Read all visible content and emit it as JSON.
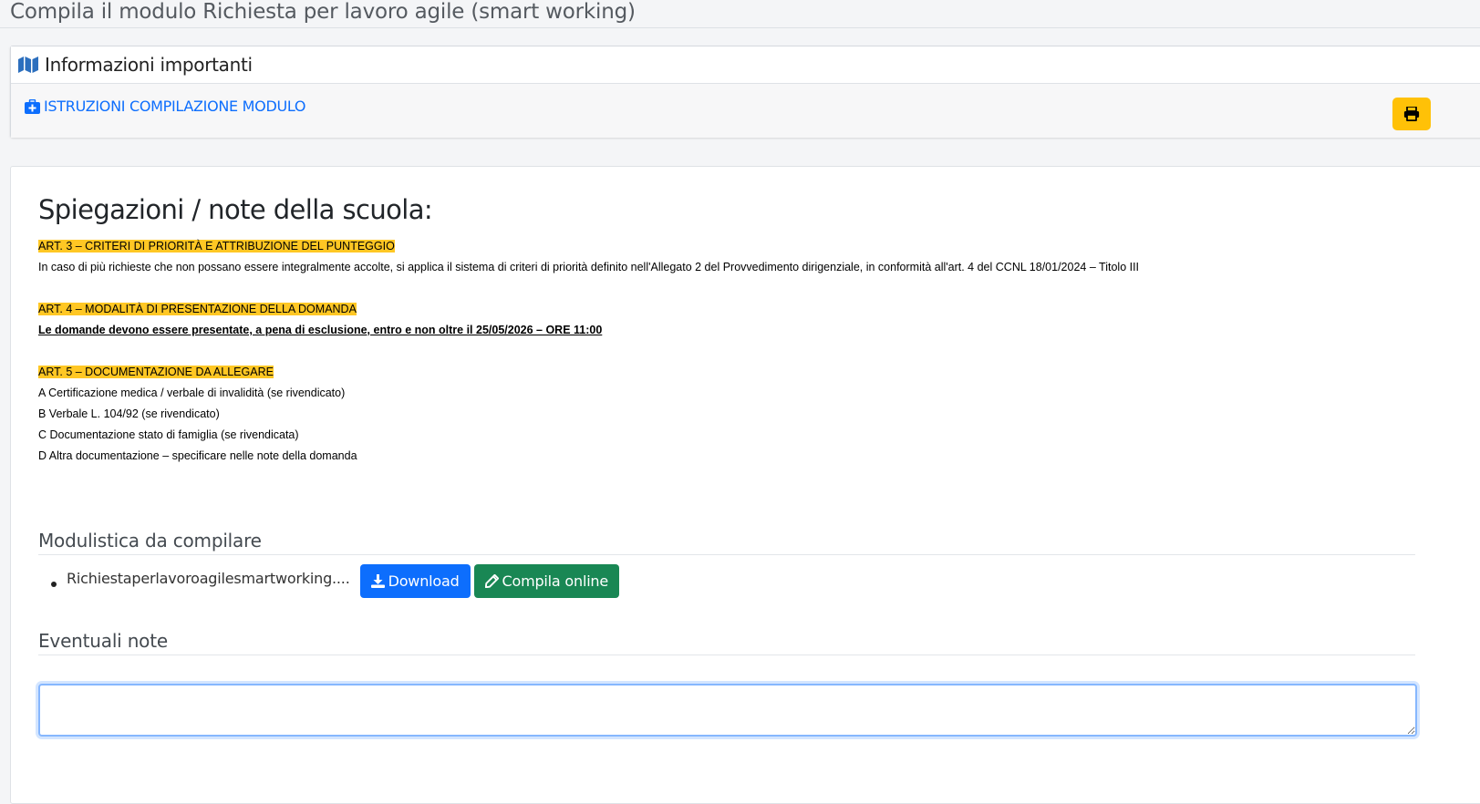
{
  "page": {
    "title": "Compila il modulo Richiesta per lavoro agile (smart working)"
  },
  "info_card": {
    "header_icon": "map-icon",
    "header_title": "Informazioni importanti",
    "instructions_icon": "medkit-icon",
    "instructions_link": "ISTRUZIONI COMPILAZIONE MODULO",
    "print_icon": "print-icon"
  },
  "notes": {
    "title": "Spiegazioni / note della scuola:",
    "art3_heading": "ART. 3 – CRITERI DI PRIORITÀ E ATTRIBUZIONE DEL PUNTEGGIO",
    "art3_text": "In caso di più richieste che non possano essere integralmente accolte, si applica il sistema di criteri di priorità definito nell'Allegato 2 del Provvedimento dirigenziale, in conformità all'art. 4 del CCNL 18/01/2024 – Titolo III",
    "art4_heading": "ART. 4 – MODALITÀ DI PRESENTAZIONE DELLA DOMANDA",
    "art4_text": "Le domande devono essere presentate, a pena di esclusione, entro e non oltre il 25/05/2026 – ORE 11:00",
    "art5_heading": "ART. 5 – DOCUMENTAZIONE DA ALLEGARE",
    "art5_items": [
      "A Certificazione medica / verbale di invalidità (se rivendicato)",
      "B Verbale L. 104/92 (se rivendicato)",
      "C Documentazione stato di famiglia (se rivendicata)",
      "D Altra documentazione – specificare nelle note della domanda"
    ]
  },
  "forms": {
    "heading": "Modulistica da compilare",
    "items": [
      {
        "file_name": "Richiestaperlavoroagilesmartworking....",
        "download_label": "Download",
        "download_icon": "download-icon",
        "compile_label": "Compila online",
        "compile_icon": "pencil-icon"
      }
    ]
  },
  "extra_notes": {
    "heading": "Eventuali note",
    "value": "",
    "placeholder": ""
  },
  "colors": {
    "link": "#0d6efd",
    "highlight": "#ffc724",
    "print_button": "#ffc107",
    "download_button": "#0d6efd",
    "compile_button": "#198754"
  }
}
